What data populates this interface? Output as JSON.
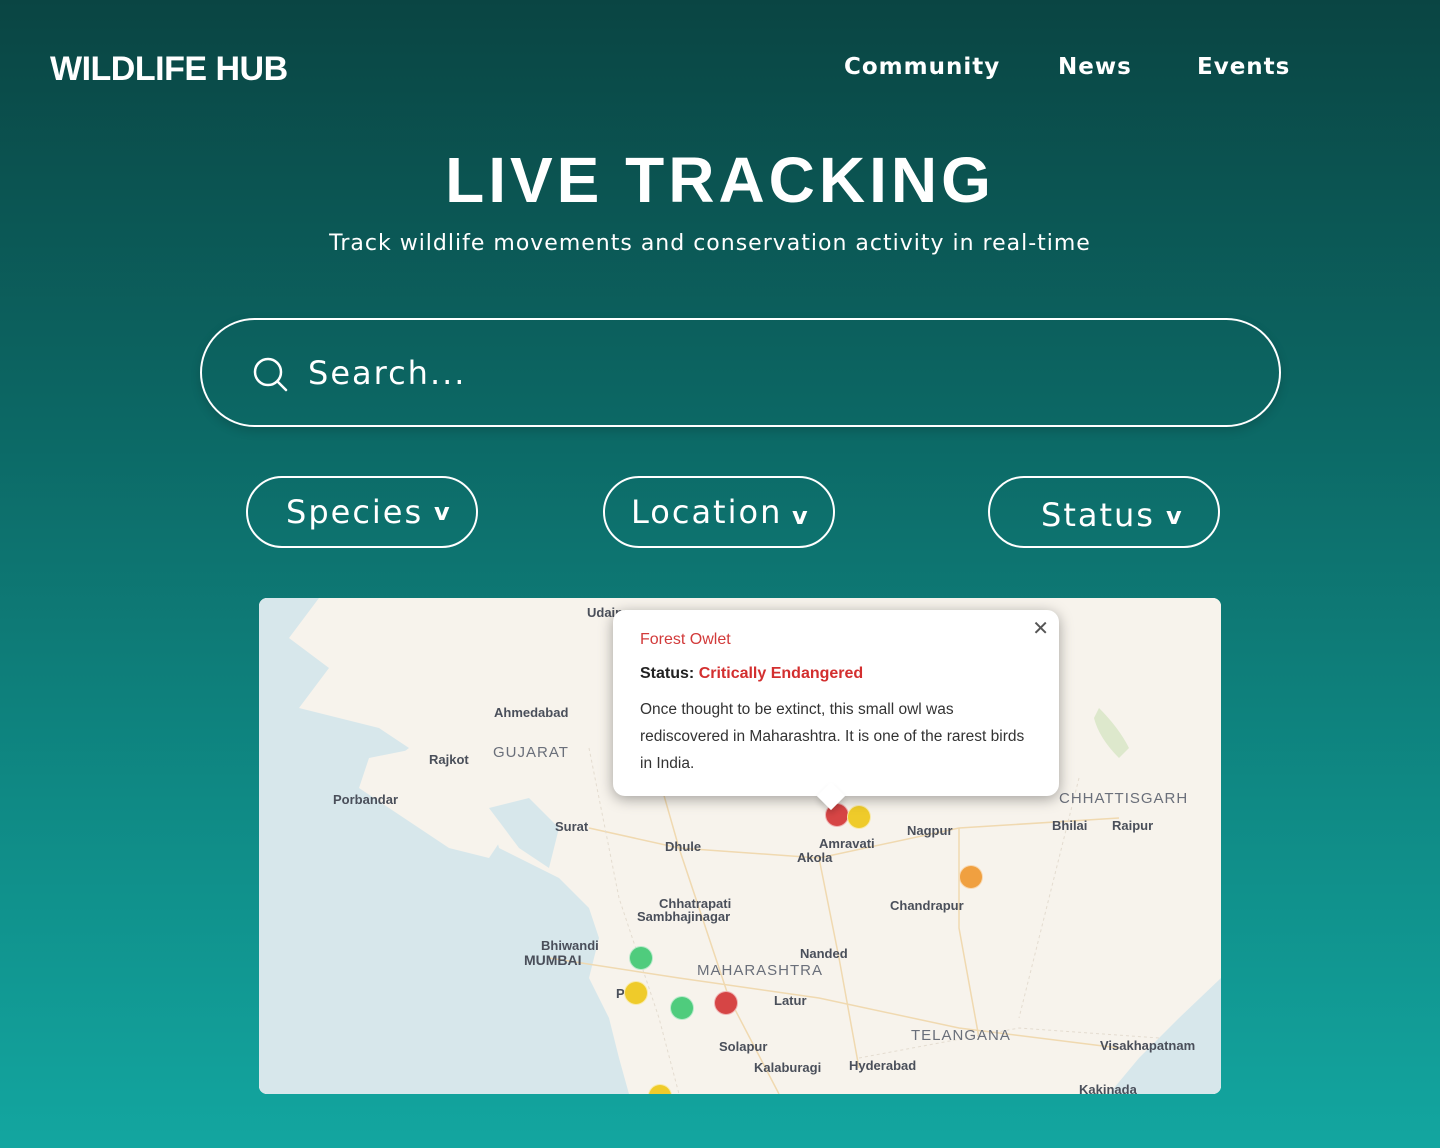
{
  "header": {
    "logo": "WILDLIFE HUB",
    "nav": [
      "Community",
      "News",
      "Events"
    ]
  },
  "hero": {
    "title": "LIVE TRACKING",
    "subtitle": "Track wildlife movements and conservation activity in real-time"
  },
  "search": {
    "placeholder": "Search...",
    "icon": "search-icon"
  },
  "filters": [
    {
      "label": "Species",
      "icon": "chevron-down-icon"
    },
    {
      "label": "Location",
      "icon": "chevron-down-icon"
    },
    {
      "label": "Status",
      "icon": "chevron-down-icon"
    }
  ],
  "map": {
    "places": [
      "Udaipur",
      "Ahmedabad",
      "Rajkot",
      "Porbandar",
      "Surat",
      "Dhule",
      "Amravati",
      "Akola",
      "Nagpur",
      "Bhilai",
      "Raipur",
      "Chandrapur",
      "Chhatrapati",
      "Sambhajinagar",
      "Bhiwandi",
      "MUMBAI",
      "Nanded",
      "Pune",
      "Latur",
      "Solapur",
      "Kalaburagi",
      "Hyderabad",
      "Visakhapatnam",
      "Kakinada"
    ],
    "regions": [
      "GUJARAT",
      "CHHATTISGARH",
      "MAHARASHTRA",
      "TELANGANA"
    ],
    "marker_colors": {
      "critical": "#d64545",
      "endangered": "#f0a040",
      "vulnerable": "#efcb2a",
      "stable": "#4fcc7d"
    }
  },
  "popup": {
    "species": "Forest Owlet",
    "status_label": "Status:",
    "status_value": "Critically Endangered",
    "description": "Once thought to be extinct, this small owl was rediscovered in Maharashtra. It is one of the rarest birds in India.",
    "close_icon": "close-icon"
  }
}
